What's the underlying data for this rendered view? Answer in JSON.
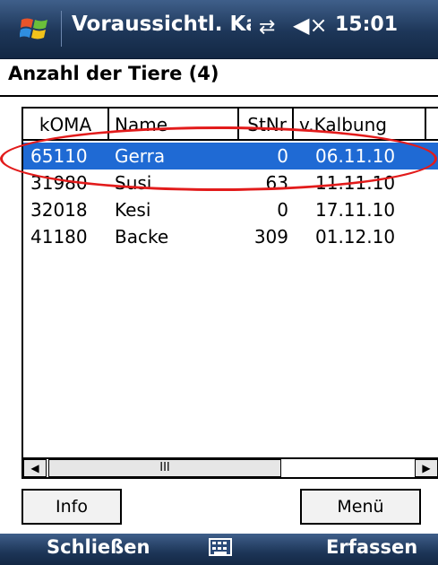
{
  "status_bar": {
    "title": "Voraussichtl. Kalbu",
    "time": "15:01",
    "connectivity_icon": "⇄",
    "volume_icon": "◀×"
  },
  "header": {
    "label": "Anzahl der Tiere (4)"
  },
  "list": {
    "columns": [
      "kOMA",
      "Name",
      "StNr",
      "v.Kalbung"
    ],
    "rows": [
      {
        "koma": "65110",
        "name": "Gerra",
        "stnr": "0",
        "kalbung": "06.11.10",
        "selected": true
      },
      {
        "koma": "31980",
        "name": "Susi",
        "stnr": "63",
        "kalbung": "11.11.10"
      },
      {
        "koma": "32018",
        "name": "Kesi",
        "stnr": "0",
        "kalbung": "17.11.10"
      },
      {
        "koma": "41180",
        "name": "Backe",
        "stnr": "309",
        "kalbung": "01.12.10"
      }
    ],
    "scroll": {
      "left_arrow": "◀",
      "right_arrow": "▶",
      "thumb_grip": "III"
    }
  },
  "buttons": {
    "info": "Info",
    "menu": "Menü"
  },
  "softkeys": {
    "left": "Schließen",
    "right": "Erfassen"
  },
  "colors": {
    "selection": "#1f6ad4",
    "highlight_ellipse": "#e21b1b",
    "bar": "#1d3658"
  }
}
